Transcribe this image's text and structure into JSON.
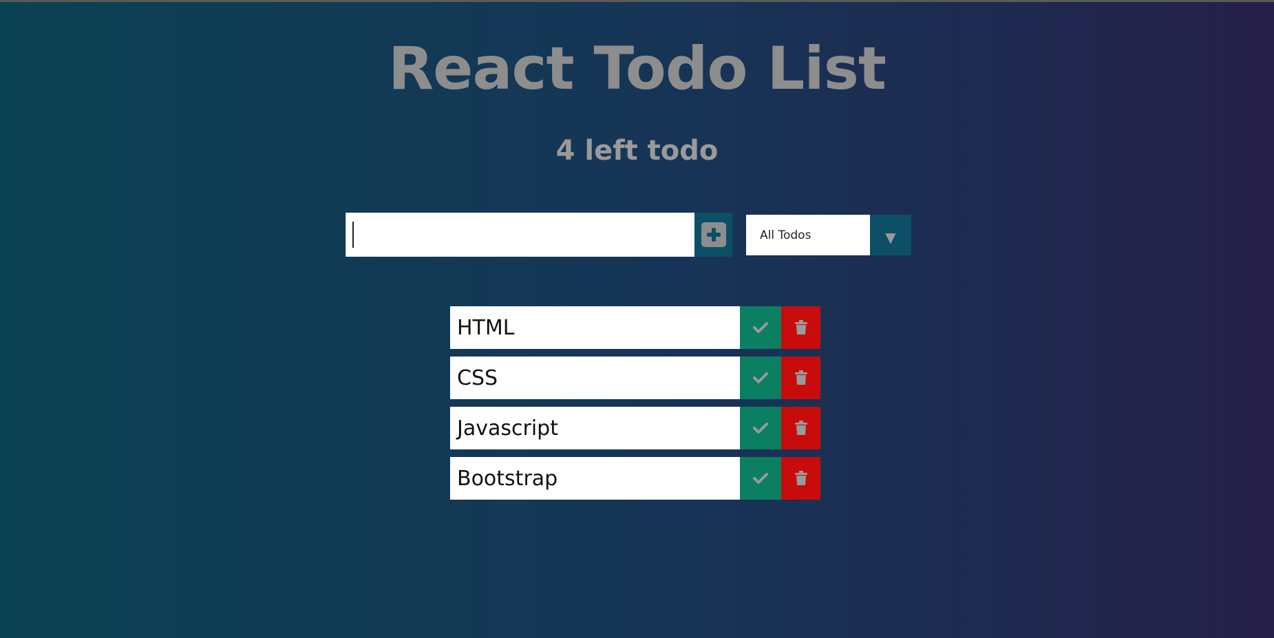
{
  "header": {
    "title": "React Todo List",
    "left_count": "4 left todo"
  },
  "form": {
    "input_value": "",
    "input_placeholder": "",
    "add_icon": "plus-square-icon"
  },
  "filter": {
    "selected": "All Todos",
    "arrow_icon": "triangle-down-icon"
  },
  "todos": [
    {
      "text": "HTML",
      "completed": false
    },
    {
      "text": "CSS",
      "completed": false
    },
    {
      "text": "Javascript",
      "completed": false
    },
    {
      "text": "Bootstrap",
      "completed": false
    }
  ],
  "colors": {
    "background_start": "#0b4253",
    "background_end": "#251f49",
    "title": "#8d8d8d",
    "accent": "#0d4f66",
    "complete": "#0b7f62",
    "delete": "#c80b0b",
    "icon": "#9a9a9a"
  }
}
